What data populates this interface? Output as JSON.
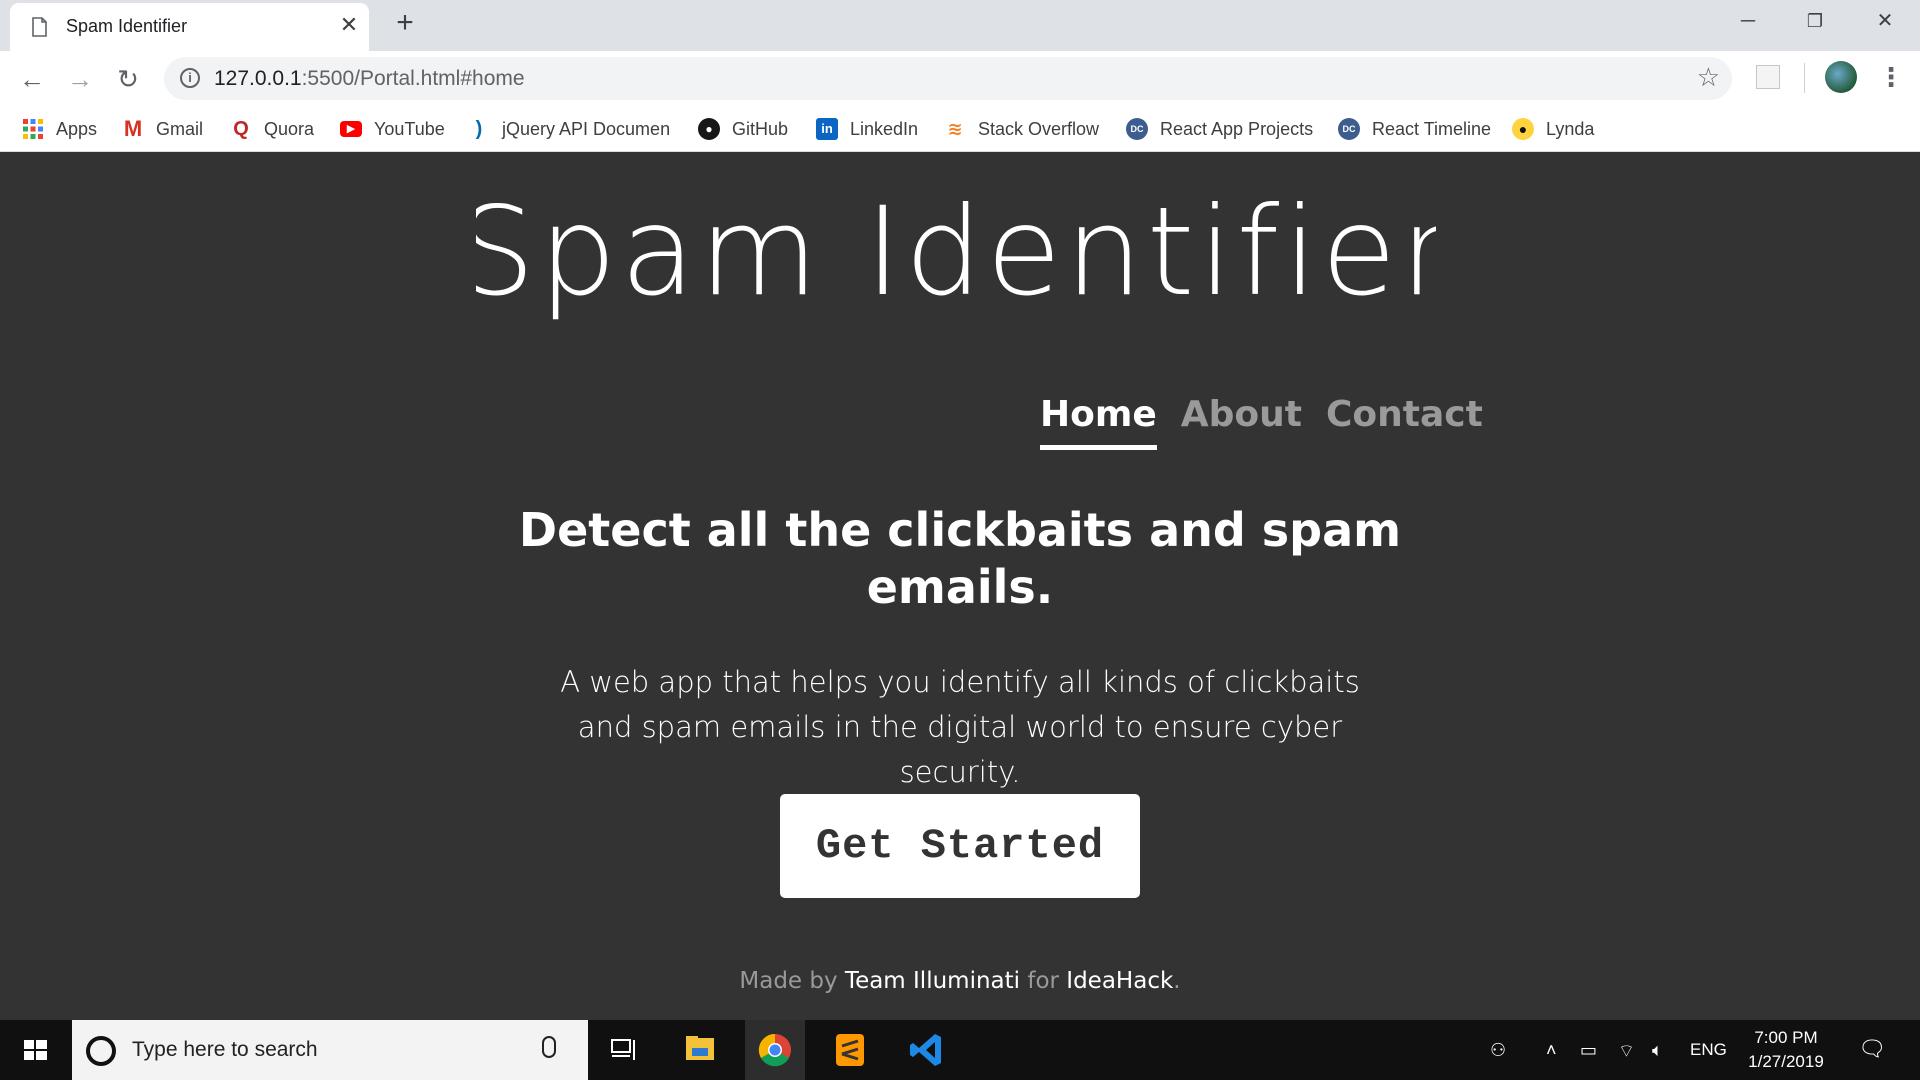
{
  "browser": {
    "tab_title": "Spam Identifier",
    "url_host": "127.0.0.1",
    "url_rest": ":5500/Portal.html#home"
  },
  "bookmarks": [
    {
      "label": "Apps",
      "icon": "apps-grid-icon"
    },
    {
      "label": "Gmail",
      "icon": "gmail-icon"
    },
    {
      "label": "Quora",
      "icon": "quora-icon"
    },
    {
      "label": "YouTube",
      "icon": "youtube-icon"
    },
    {
      "label": "jQuery API Documen",
      "icon": "jquery-icon"
    },
    {
      "label": "GitHub",
      "icon": "github-icon"
    },
    {
      "label": "LinkedIn",
      "icon": "linkedin-icon"
    },
    {
      "label": "Stack Overflow",
      "icon": "stackoverflow-icon"
    },
    {
      "label": "React App Projects",
      "icon": "dc-icon"
    },
    {
      "label": "React Timeline",
      "icon": "dc-icon"
    },
    {
      "label": "Lynda",
      "icon": "lynda-icon"
    }
  ],
  "page": {
    "logo_text": "Spam Identifier",
    "nav": [
      {
        "label": "Home",
        "active": true
      },
      {
        "label": "About",
        "active": false
      },
      {
        "label": "Contact",
        "active": false
      }
    ],
    "headline": "Detect all the clickbaits and spam emails.",
    "lead": "A web app that helps you identify all kinds of clickbaits and spam emails in the digital world to ensure cyber security.",
    "cta_label": "Get Started",
    "footer": {
      "prefix": "Made by",
      "team": "Team Illuminati",
      "mid": "for",
      "event": "IdeaHack",
      "suffix": "."
    }
  },
  "taskbar": {
    "search_placeholder": "Type here to search",
    "language": "ENG",
    "time": "7:00 PM",
    "date": "1/27/2019"
  },
  "colors": {
    "page_bg": "#333333",
    "nav_inactive": "#9a9a9a",
    "chrome_tabstrip": "#dee1e6"
  }
}
